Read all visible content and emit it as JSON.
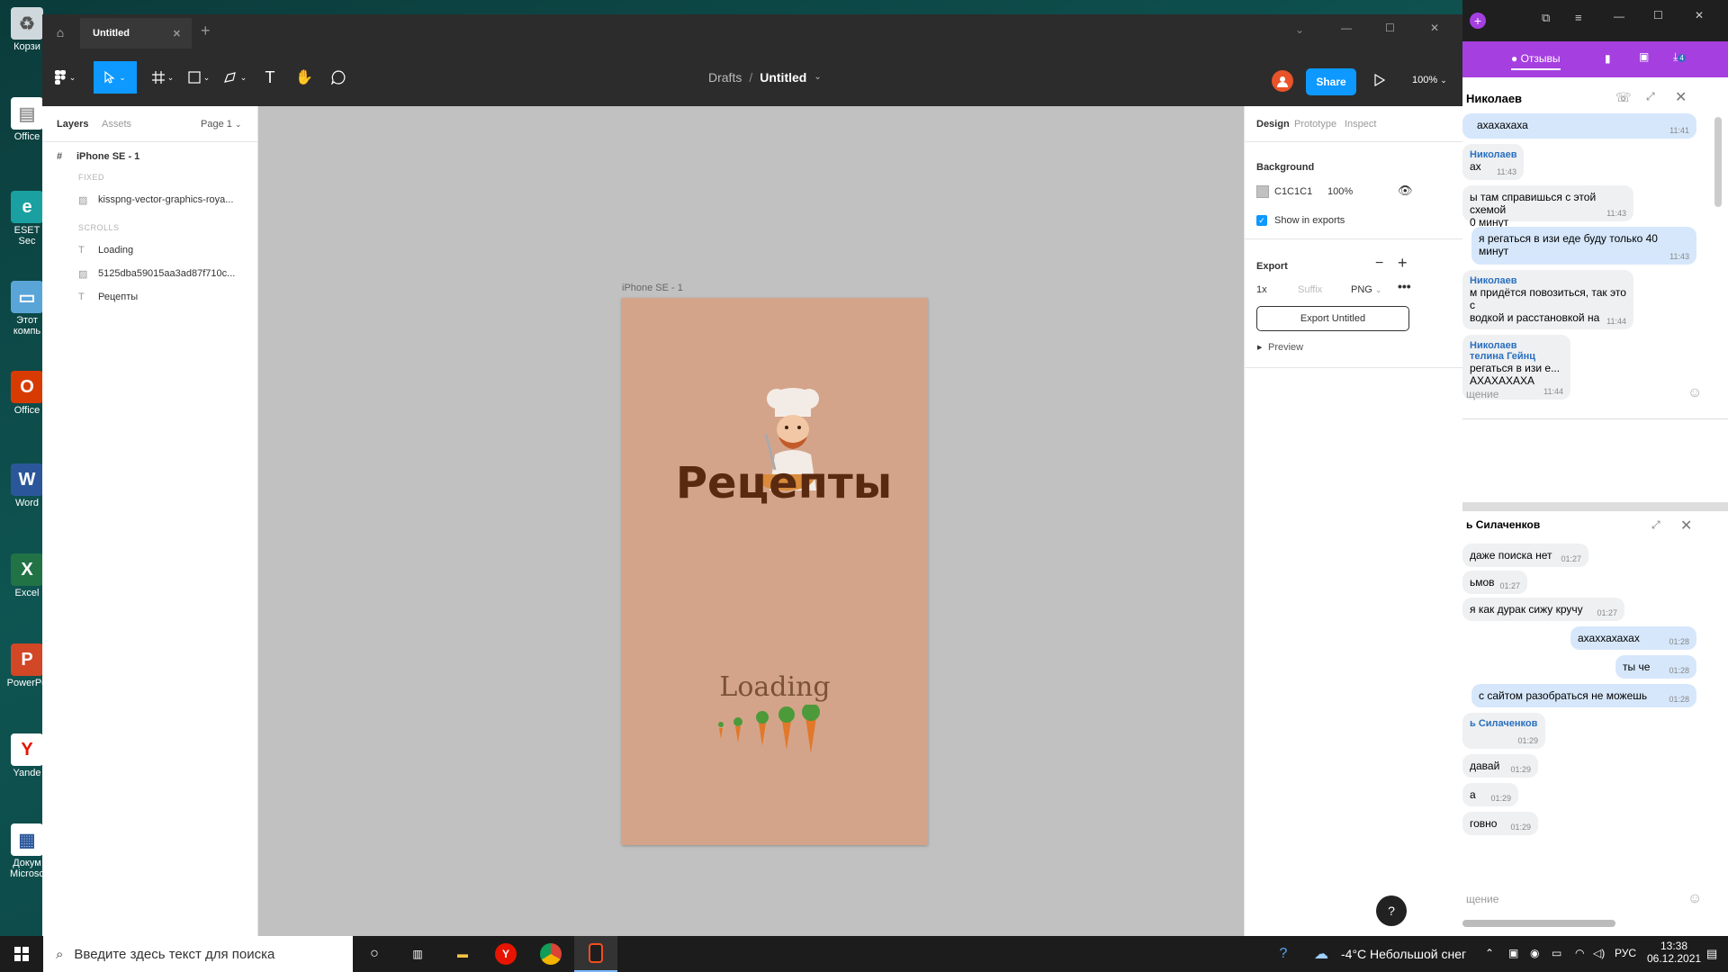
{
  "desktop": {
    "icons": [
      "Корзи",
      "Office",
      "ESET Sec",
      "Этот компь",
      "Office",
      "Word",
      "Excel",
      "PowerPo",
      "Yande",
      "Докум Microsc"
    ]
  },
  "figma": {
    "tab_title": "Untitled",
    "breadcrumb_parent": "Drafts",
    "breadcrumb_sep": "/",
    "file_title": "Untitled",
    "share_label": "Share",
    "zoom_label": "100%",
    "left_tabs": {
      "layers": "Layers",
      "assets": "Assets",
      "page": "Page 1"
    },
    "frame_layer": "iPhone SE - 1",
    "section_fixed": "FIXED",
    "section_scrolls": "SCROLLS",
    "layers": [
      {
        "name": "kisspng-vector-graphics-roya...",
        "icon": "image-icon"
      },
      {
        "name": "Loading",
        "icon": "text-icon"
      },
      {
        "name": "5125dba59015aa3ad87f710c...",
        "icon": "image-icon"
      },
      {
        "name": "Рецепты",
        "icon": "text-icon"
      }
    ],
    "frame_label": "iPhone SE - 1",
    "frame_title": "Рецепты",
    "frame_loading": "Loading",
    "right_tabs": {
      "design": "Design",
      "prototype": "Prototype",
      "inspect": "Inspect"
    },
    "background_label": "Background",
    "bg_hex": "C1C1C1",
    "bg_opacity": "100%",
    "show_in_exports": "Show in exports",
    "export_label": "Export",
    "export_scale": "1x",
    "export_suffix_placeholder": "Suffix",
    "export_format": "PNG",
    "export_button": "Export Untitled",
    "preview_label": "Preview",
    "help": "?",
    "colors": {
      "frame_bg": "#d4a48a",
      "title": "#5a2a10",
      "accent": "#0d99ff"
    }
  },
  "chat": {
    "top_badge": "Отзывы",
    "chat1_name": "Николаев",
    "chat1_messages": [
      {
        "type": "out",
        "text": "ахахахаха",
        "time": "11:41"
      },
      {
        "type": "in",
        "name": "Николаев",
        "text": "ах",
        "time": "11:43"
      },
      {
        "type": "in",
        "text": "ы там справишься с этой схемой\n0 минут",
        "time": "11:43"
      },
      {
        "type": "out",
        "text": "я регаться в изи еде буду только 40\nминут",
        "time": "11:43"
      },
      {
        "type": "in",
        "name": "Николаев",
        "text": "м придётся повозиться, так это с\nводкой и расстановкой на",
        "time": "11:44"
      },
      {
        "type": "in",
        "name": "Николаев",
        "name2": "телина Гейнц",
        "text": "регаться в изи е...\nАХАХАХАХА",
        "time": "11:44"
      }
    ],
    "input_placeholder1": "щение",
    "chat2_name": "ь Силаченков",
    "chat2_messages": [
      {
        "type": "in",
        "text": "даже поиска нет",
        "time": "01:27"
      },
      {
        "type": "in",
        "text": "ьмов",
        "time": "01:27"
      },
      {
        "type": "in",
        "text": "я как дурак сижу кручу",
        "time": "01:27"
      },
      {
        "type": "out",
        "text": "ахаххахахах",
        "time": "01:28"
      },
      {
        "type": "out",
        "text": "ты че",
        "time": "01:28"
      },
      {
        "type": "out",
        "text": "с сайтом разобраться не можешь",
        "time": "01:28"
      },
      {
        "type": "in",
        "name": "ь Силаченков",
        "text": "",
        "time": "01:29"
      },
      {
        "type": "in",
        "text": "давай",
        "time": "01:29"
      },
      {
        "type": "in",
        "text": "а",
        "time": "01:29"
      },
      {
        "type": "in",
        "text": "говно",
        "time": "01:29"
      }
    ],
    "input_placeholder2": "щение",
    "unread_count": "4"
  },
  "taskbar": {
    "search_placeholder": "Введите здесь текст для поиска",
    "weather": "-4°C  Небольшой снег",
    "lang": "РУС",
    "time": "13:38",
    "date": "06.12.2021"
  }
}
